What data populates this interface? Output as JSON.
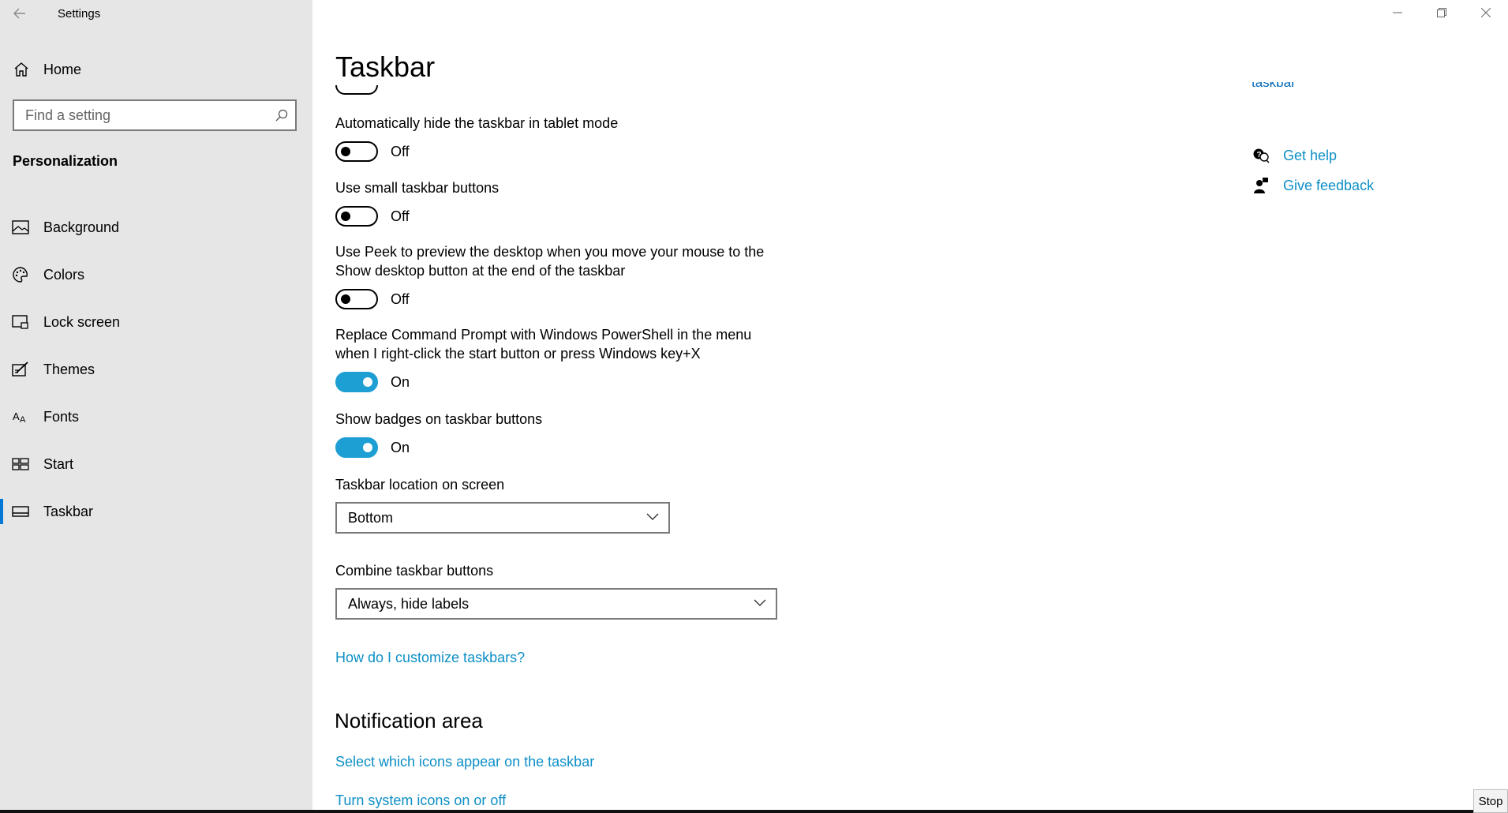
{
  "window": {
    "app_title": "Settings",
    "controls": [
      "minimize",
      "restore",
      "close"
    ]
  },
  "sidebar": {
    "home_label": "Home",
    "search_placeholder": "Find a setting",
    "section_title": "Personalization",
    "items": [
      {
        "label": "Background",
        "icon": "picture-icon"
      },
      {
        "label": "Colors",
        "icon": "palette-icon"
      },
      {
        "label": "Lock screen",
        "icon": "lock-screen-icon"
      },
      {
        "label": "Themes",
        "icon": "themes-icon"
      },
      {
        "label": "Fonts",
        "icon": "fonts-icon"
      },
      {
        "label": "Start",
        "icon": "start-icon"
      },
      {
        "label": "Taskbar",
        "icon": "taskbar-icon",
        "selected": true
      }
    ]
  },
  "main": {
    "title": "Taskbar",
    "settings": [
      {
        "title": "Automatically hide the taskbar in tablet mode",
        "state": "Off"
      },
      {
        "title": "Use small taskbar buttons",
        "state": "Off"
      },
      {
        "title": "Use Peek to preview the desktop when you move your mouse to the Show desktop button at the end of the taskbar",
        "state": "Off"
      },
      {
        "title": "Replace Command Prompt with Windows PowerShell in the menu when I right-click the start button or press Windows key+X",
        "state": "On"
      },
      {
        "title": "Show badges on taskbar buttons",
        "state": "On"
      }
    ],
    "location": {
      "label": "Taskbar location on screen",
      "value": "Bottom"
    },
    "combine": {
      "label": "Combine taskbar buttons",
      "value": "Always, hide labels"
    },
    "customize_link": "How do I customize taskbars?",
    "notification_heading": "Notification area",
    "notification_links": [
      "Select which icons appear on the taskbar",
      "Turn system icons on or off"
    ],
    "clipped_link_fragment": "taskbar"
  },
  "help": {
    "get_help": "Get help",
    "give_feedback": "Give feedback"
  },
  "overlay": {
    "stop_label": "Stop"
  },
  "colors": {
    "accent": "#1e9fd3",
    "link": "#0d8fc6",
    "sidebar_bg": "#e6e6e6"
  }
}
